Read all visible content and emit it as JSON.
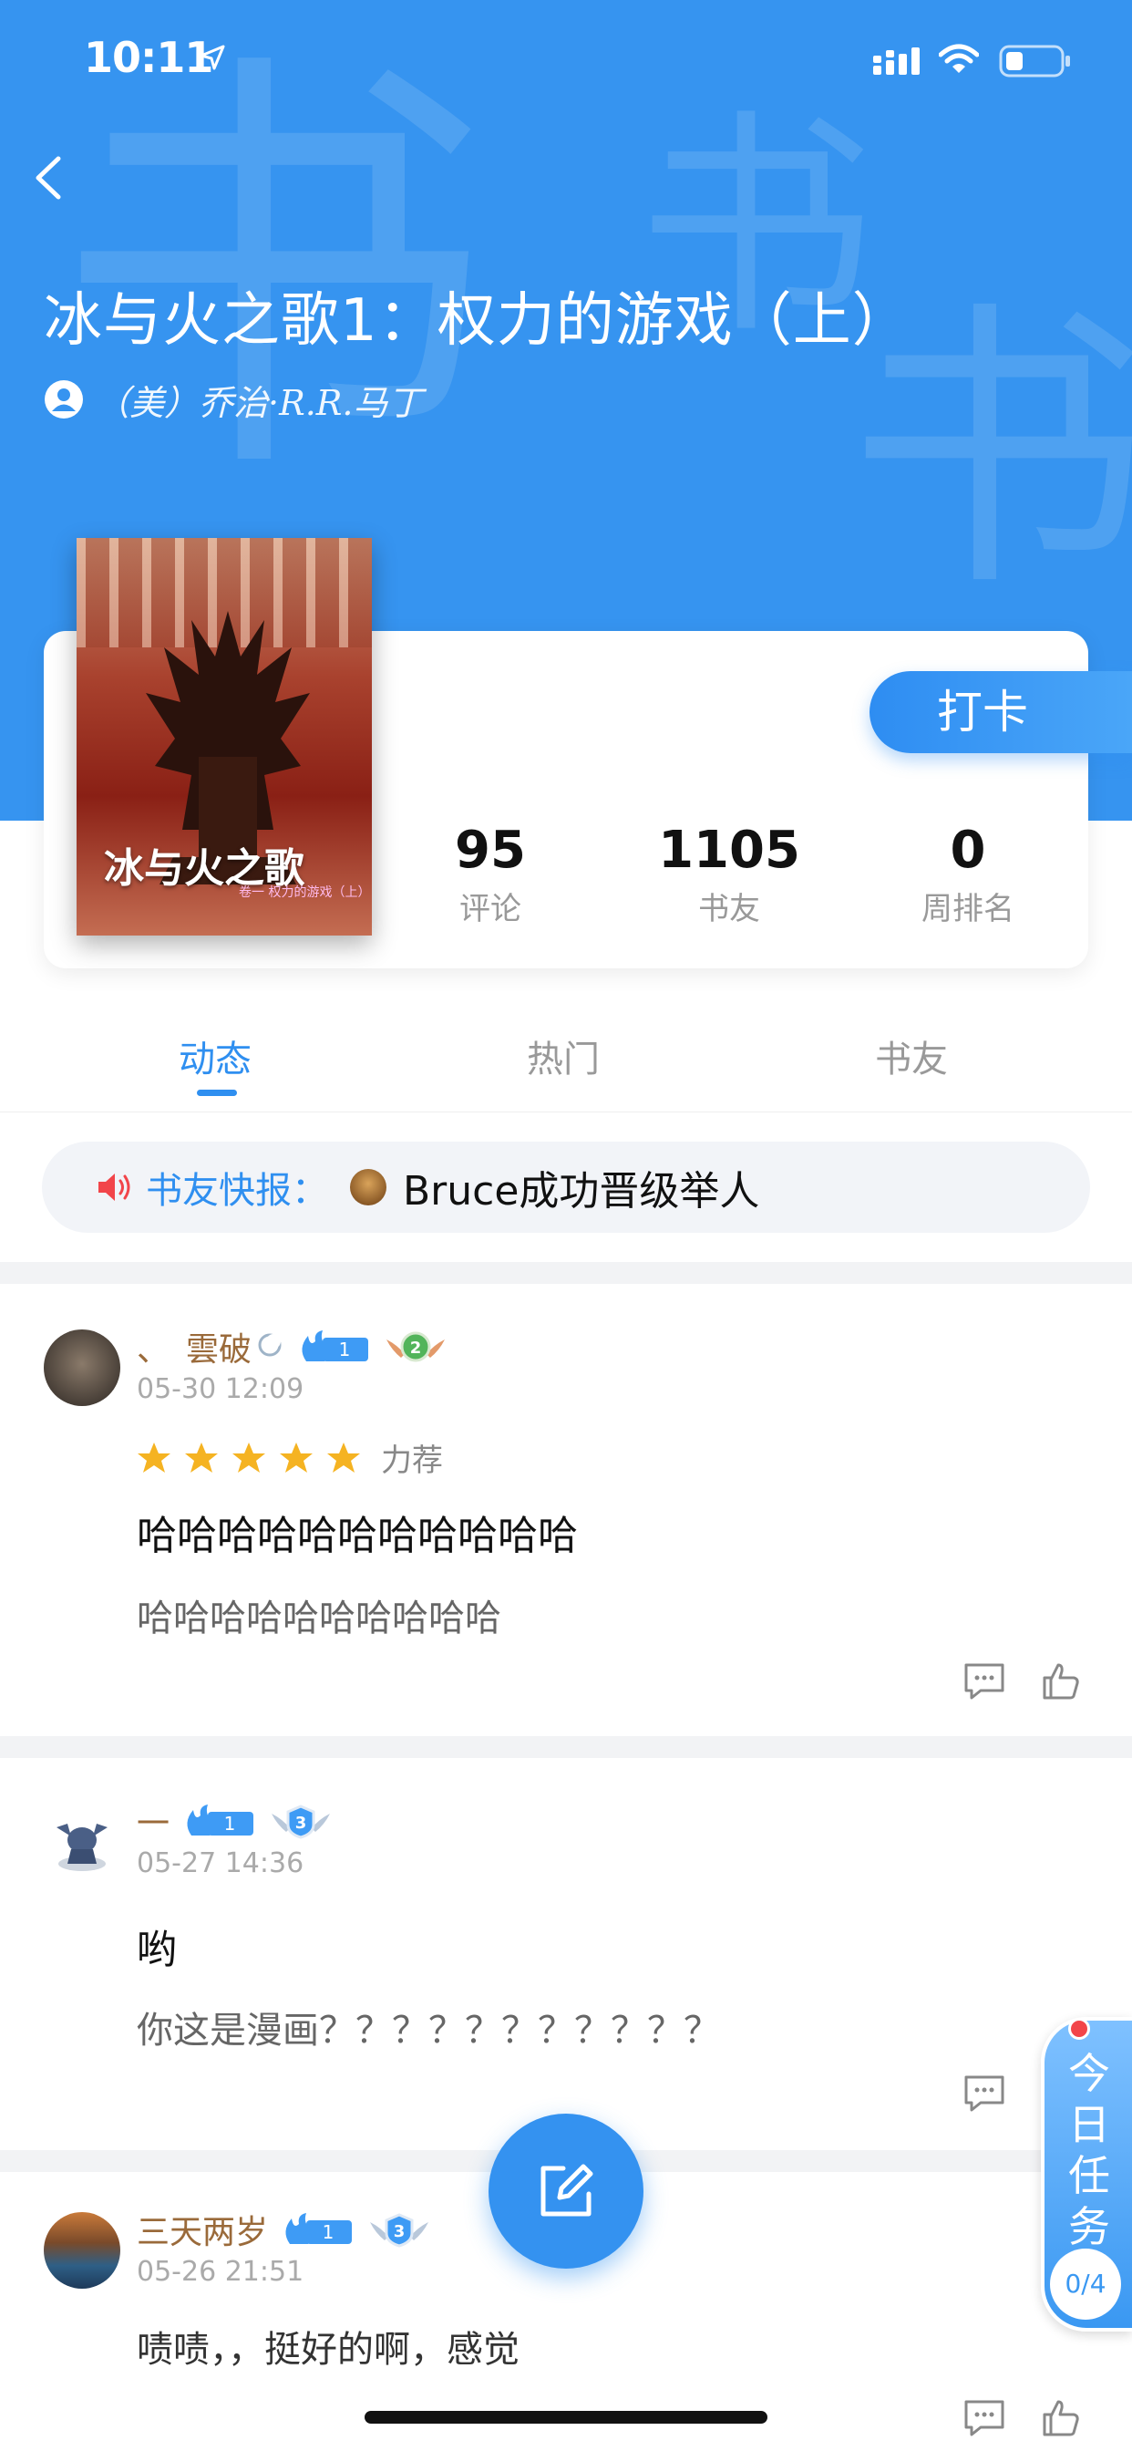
{
  "status_bar": {
    "time": "10:11"
  },
  "header": {
    "watermark_char": "书",
    "book_title": "冰与火之歌1：权力的游戏（上）",
    "author": "（美）乔治·R.R.马丁"
  },
  "cover": {
    "title": "冰与火之歌",
    "subtitle": "卷一 权力的游戏（上）"
  },
  "checkin_label": "打卡",
  "stats": [
    {
      "value": "95",
      "label": "评论"
    },
    {
      "value": "1105",
      "label": "书友"
    },
    {
      "value": "0",
      "label": "周排名"
    }
  ],
  "tabs": [
    {
      "label": "动态",
      "active": true
    },
    {
      "label": "热门",
      "active": false
    },
    {
      "label": "书友",
      "active": false
    }
  ],
  "news": {
    "label": "书友快报：",
    "text": "Bruce成功晋级举人"
  },
  "posts": [
    {
      "username": "、　雲破",
      "level": "1",
      "rank": "2",
      "time": "05-30 12:09",
      "stars": 5,
      "rating_text": "力荐",
      "title": "哈哈哈哈哈哈哈哈哈哈哈",
      "body": "哈哈哈哈哈哈哈哈哈哈"
    },
    {
      "username": "一",
      "level": "1",
      "rank": "3",
      "time": "05-27 14:36",
      "title": "哟",
      "body": "你这是漫画？？？？？？？？？？？"
    },
    {
      "username": "三天两岁",
      "level": "1",
      "rank": "3",
      "time": "05-26 21:51",
      "body": "啧啧，，挺好的啊，感觉"
    }
  ],
  "task": {
    "label": "今日任务",
    "count": "0/4"
  },
  "colors": {
    "primary": "#3694f0",
    "accent_red": "#f2454a",
    "star": "#f5b322",
    "username": "#9a6a3a"
  }
}
